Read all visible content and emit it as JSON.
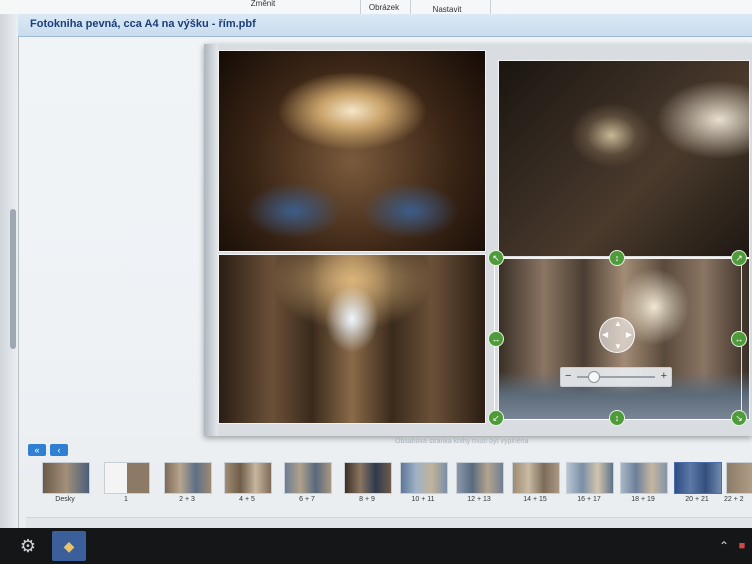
{
  "toolbar": {
    "buttons": [
      {
        "label": "Změnit"
      },
      {
        "label": "Obrázek"
      },
      {
        "label": "Nastavit"
      }
    ]
  },
  "window": {
    "title": "Fotokniha pevná, cca A4 na výšku - řím.pbf"
  },
  "canvas": {
    "page_note": "Obsahová stránka knihy musí být vyplněna"
  },
  "navigation": {
    "first_label": "«",
    "prev_label": "‹"
  },
  "thumbnails": [
    {
      "label": "Desky"
    },
    {
      "label": "1"
    },
    {
      "label": "2 + 3"
    },
    {
      "label": "4 + 5"
    },
    {
      "label": "6 + 7"
    },
    {
      "label": "8 + 9"
    },
    {
      "label": "10 + 11"
    },
    {
      "label": "12 + 13"
    },
    {
      "label": "14 + 15"
    },
    {
      "label": "16 + 17"
    },
    {
      "label": "18 + 19"
    },
    {
      "label": "20 + 21"
    },
    {
      "label": "22 + 2"
    }
  ],
  "zoom": {
    "minus_label": "−",
    "plus_label": "+",
    "level": 0.15
  },
  "icons": {
    "settings": "gear-icon",
    "app": "photobook-app-icon"
  }
}
